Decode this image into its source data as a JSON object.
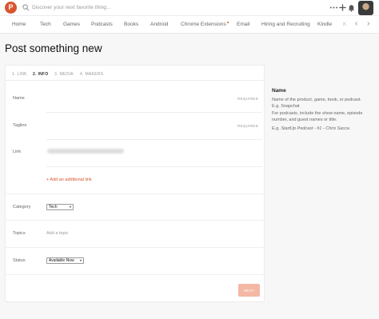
{
  "header": {
    "logo_letter": "P",
    "search_placeholder": "Discover your next favorite thing...",
    "icons": [
      "search-icon",
      "more-icon",
      "plus-icon",
      "bell-icon",
      "avatar"
    ]
  },
  "nav": {
    "items": [
      "Home",
      "Tech",
      "Games",
      "Podcasts",
      "Books",
      "Android",
      "Chrome Extensions",
      "Email",
      "Hiring and Recruiting",
      "Kindle"
    ],
    "overflow_text": "K",
    "highlight_item": "Chrome Extensions",
    "prev_arrow": "‹",
    "next_arrow": "›"
  },
  "page": {
    "title": "Post something new"
  },
  "form": {
    "steps": [
      {
        "label": "1. LINK",
        "active": false
      },
      {
        "label": "2. INFO",
        "active": true
      },
      {
        "label": "3. MEDIA",
        "active": false
      },
      {
        "label": "4. MAKERS",
        "active": false
      }
    ],
    "fields": {
      "name": {
        "label": "Name",
        "required": "REQUIRED"
      },
      "tagline": {
        "label": "Tagline",
        "required": "REQUIRED"
      },
      "link": {
        "label": "Link",
        "add_link": "+ Add an additional link"
      },
      "category": {
        "label": "Category",
        "value": "Tech"
      },
      "topics": {
        "label": "Topics",
        "placeholder": "Add a topic"
      },
      "status": {
        "label": "Status",
        "value": "Available Now"
      }
    },
    "next_button": "NEXT"
  },
  "help": {
    "title": "Name",
    "para1": "Name of the product, game, book, or podcast. E.g. Snapchat",
    "para2": "For podcasts, include the show name, episode number, and guest names or title.",
    "example_prefix": "E.g. ",
    "example_italic": "StartUp Podcast - #1 - Chris Sacca"
  },
  "colors": {
    "accent": "#da552f",
    "button_disabled": "#f4b7a4",
    "background": "#f7f7f7"
  }
}
